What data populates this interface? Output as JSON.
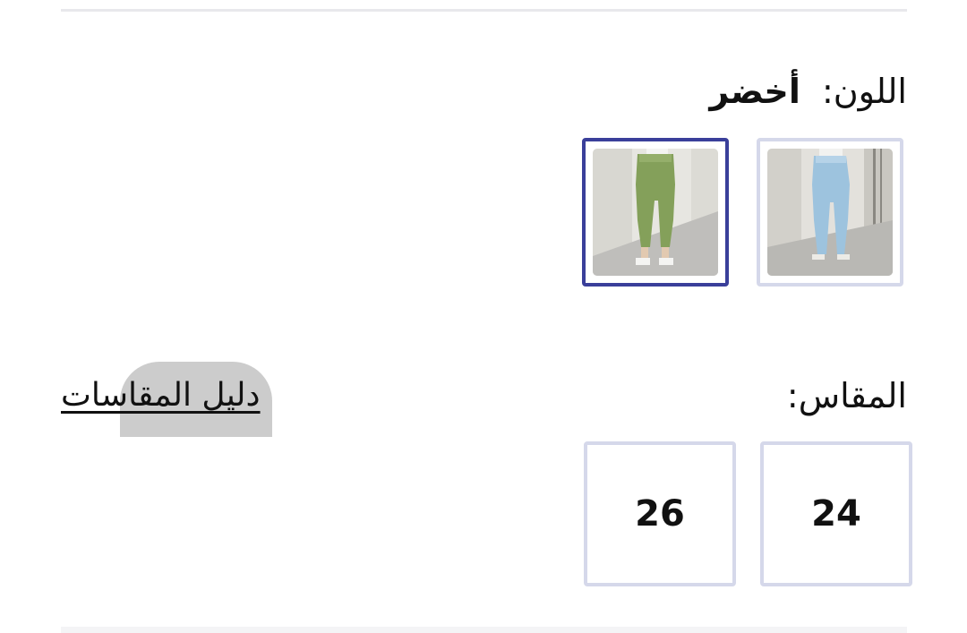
{
  "color": {
    "label": "اللون:",
    "selected_value": "أخضر",
    "swatches": [
      {
        "name": "light-blue-jeans",
        "selected": false
      },
      {
        "name": "green-trousers",
        "selected": true
      }
    ],
    "selected_border_color": "#3a3f9a",
    "border_color": "#d5d8ea"
  },
  "size": {
    "label": "المقاس:",
    "guide_link": "دليل المقاسات",
    "options": [
      "24",
      "26"
    ]
  }
}
